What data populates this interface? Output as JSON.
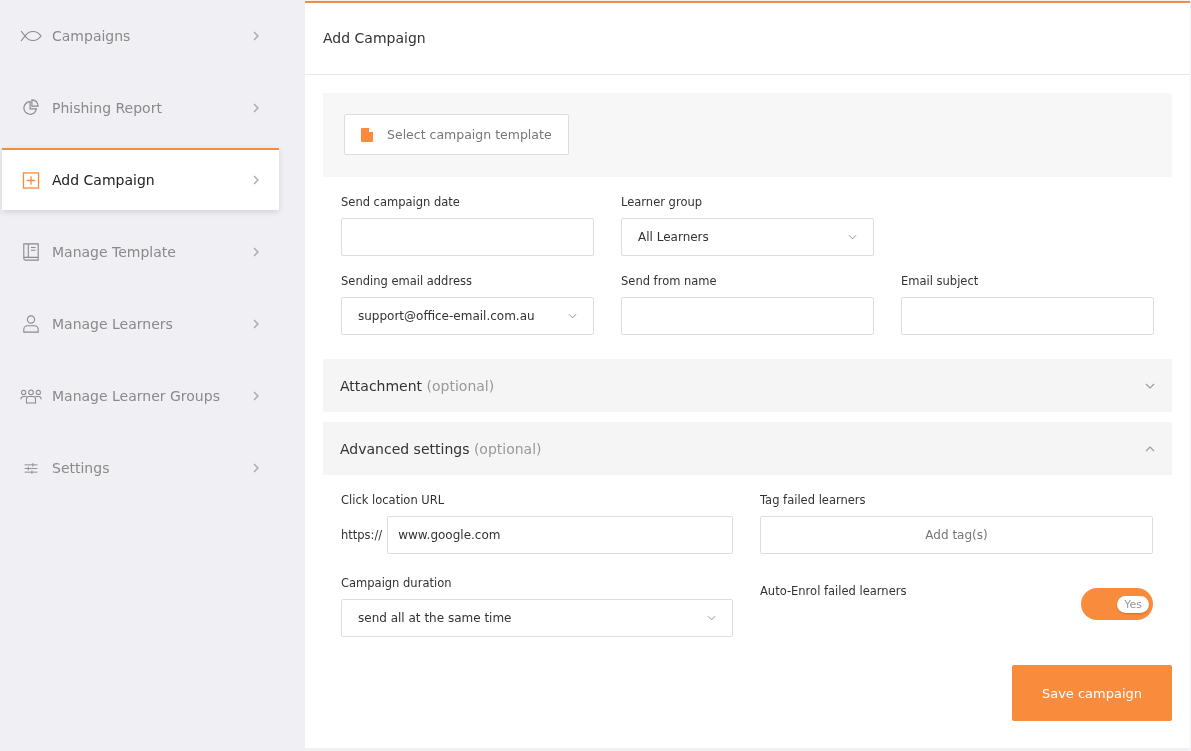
{
  "sidebar": {
    "items": [
      {
        "label": "Campaigns",
        "selected": false
      },
      {
        "label": "Phishing Report",
        "selected": false
      },
      {
        "label": "Add Campaign",
        "selected": true
      },
      {
        "label": "Manage Template",
        "selected": false
      },
      {
        "label": "Manage Learners",
        "selected": false
      },
      {
        "label": "Manage Learner Groups",
        "selected": false
      },
      {
        "label": "Settings",
        "selected": false
      }
    ]
  },
  "panel": {
    "title": "Add Campaign",
    "template_button": "Select campaign template",
    "field_rows": [
      [
        {
          "kind": "text",
          "label": "Send campaign date"
        },
        {
          "kind": "select",
          "label": "Learner group",
          "value": "All Learners"
        }
      ],
      [
        {
          "kind": "select",
          "label": "Sending email address",
          "value": "support@office-email.com.au"
        },
        {
          "kind": "text",
          "label": "Send from name"
        },
        {
          "kind": "text",
          "label": "Email subject"
        }
      ]
    ],
    "sections": [
      {
        "title": "Attachment",
        "hint": "(optional)",
        "expanded": false
      },
      {
        "title": "Advanced settings",
        "hint": "(optional)",
        "expanded": true
      }
    ],
    "advanced": {
      "url": {
        "label": "Click location URL",
        "prefix": "https://",
        "value": "www.google.com"
      },
      "tags": {
        "label": "Tag failed learners",
        "placeholder": "Add tag(s)"
      },
      "duration": {
        "label": "Campaign duration",
        "value": "send all at the same time"
      },
      "auto_enrol": {
        "label": "Auto-Enrol failed learners",
        "on": true,
        "text": "Yes"
      }
    },
    "save_button": "Save campaign"
  }
}
